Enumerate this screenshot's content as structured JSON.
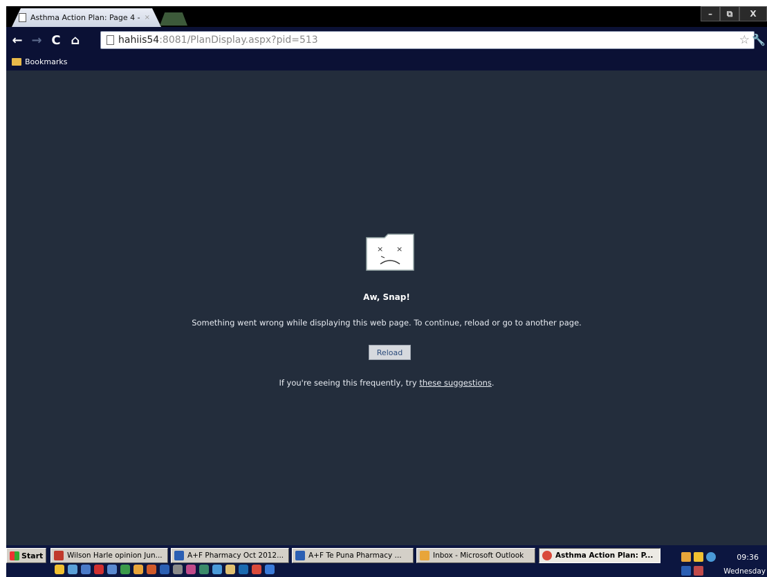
{
  "browser": {
    "tab_title": "Asthma Action Plan: Page 4 -",
    "tab_close": "×",
    "url_host": "hahiis54",
    "url_rest": ":8081/PlanDisplay.aspx?pid=513",
    "bookmarks_label": "Bookmarks",
    "window_buttons": {
      "minimize": "–",
      "maximize": "⧉",
      "close": "X"
    },
    "nav": {
      "back": "←",
      "forward": "→",
      "reload": "C",
      "home": "⌂",
      "star": "☆",
      "wrench": "🔧"
    }
  },
  "error_page": {
    "headline": "Aw, Snap!",
    "message": "Something went wrong while displaying this web page. To continue, reload or go to another page.",
    "reload_button": "Reload",
    "help_prefix": "If you're seeing this frequently, try ",
    "help_link": "these suggestions",
    "help_suffix": ".",
    "background_color": "#232d3c"
  },
  "taskbar": {
    "start_label": "Start",
    "tasks": [
      {
        "label": "Wilson Harle opinion Jun...",
        "icon": "pdf-icon",
        "color": "#c0392b"
      },
      {
        "label": "A+F Pharmacy Oct 2012...",
        "icon": "word-icon",
        "color": "#2b5fb3"
      },
      {
        "label": "A+F Te Puna Pharmacy ...",
        "icon": "word-icon",
        "color": "#2b5fb3"
      },
      {
        "label": "Inbox - Microsoft Outlook",
        "icon": "outlook-icon",
        "color": "#e8a53a"
      },
      {
        "label": "Asthma Action Plan: P...",
        "icon": "chrome-icon",
        "color": "#d94a3a"
      }
    ],
    "clock_time": "09:36",
    "clock_day": "Wednesday"
  }
}
